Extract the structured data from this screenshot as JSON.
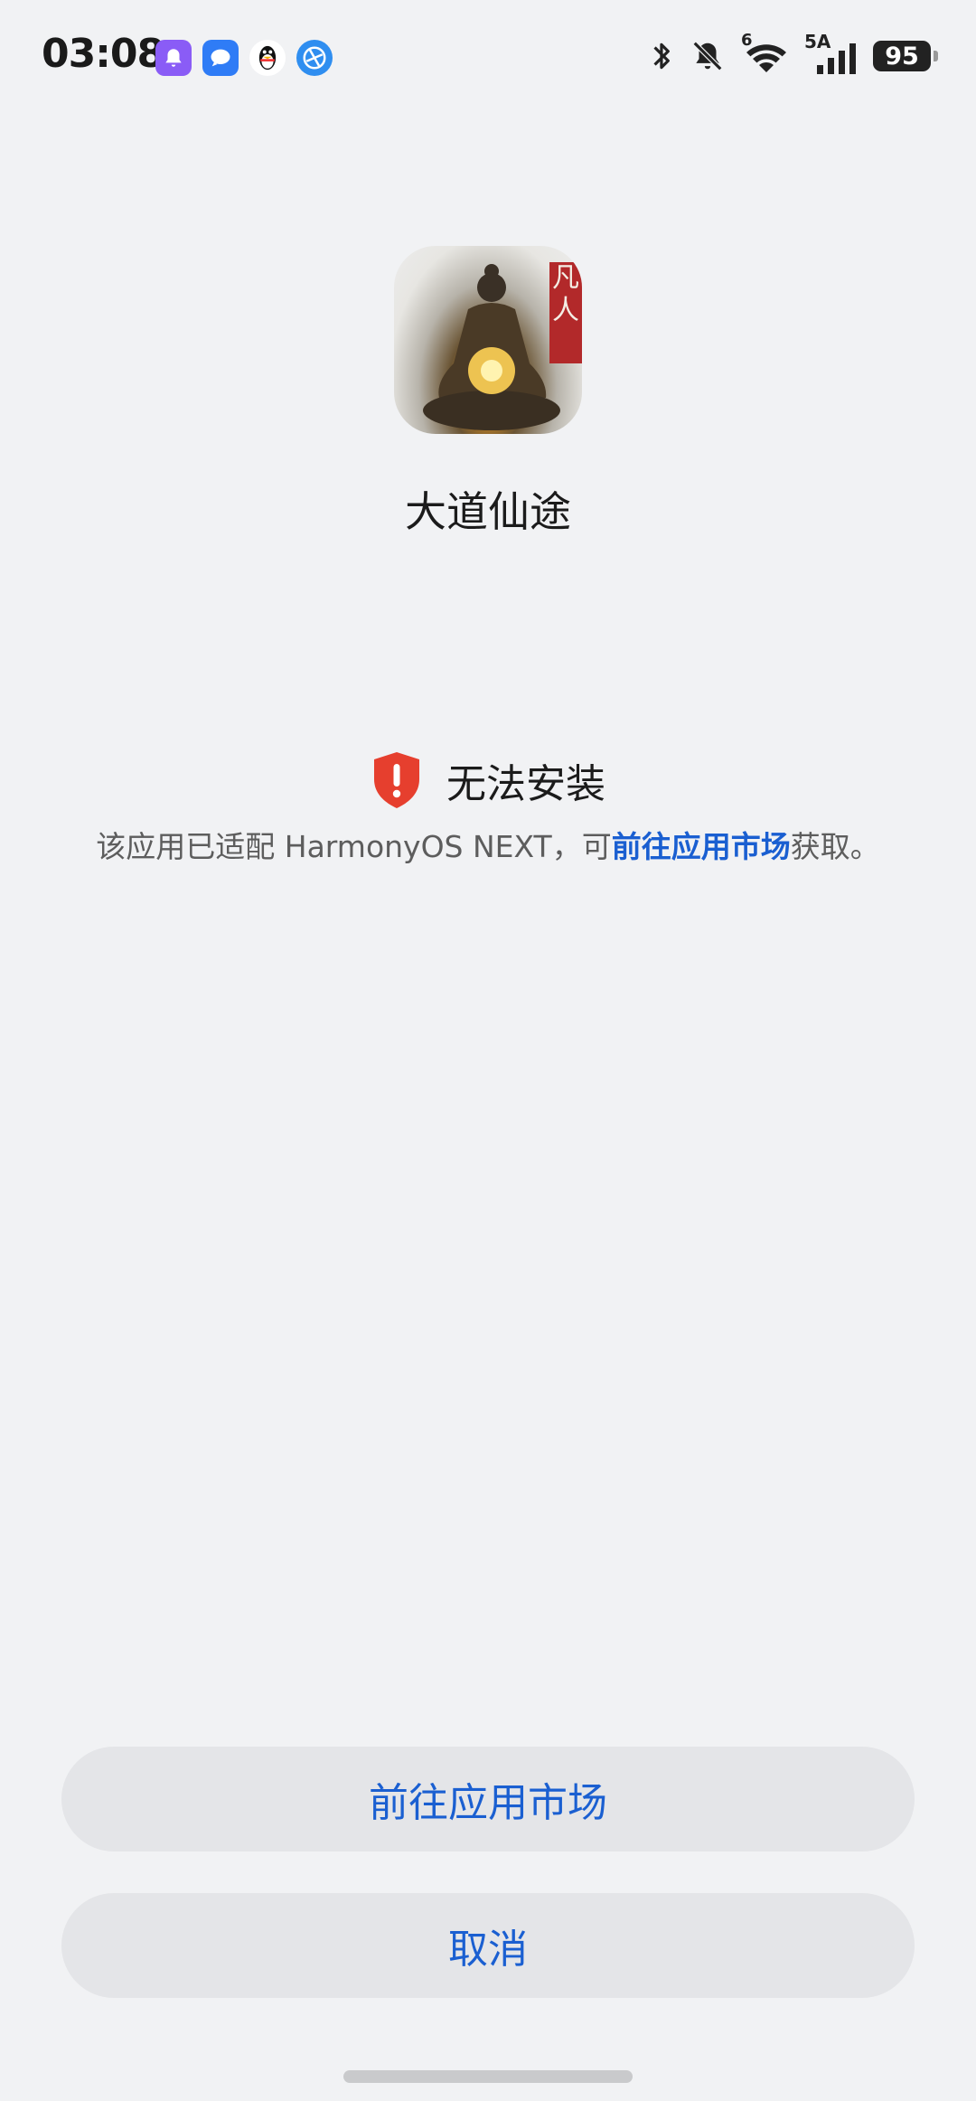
{
  "status_bar": {
    "time": "03:08",
    "network_label": "5A",
    "wifi_label": "6",
    "battery": "95",
    "notification_icons": [
      "bell-app-icon",
      "message-app-icon",
      "qq-penguin-icon",
      "browser-globe-icon"
    ],
    "system_icons": [
      "bluetooth-icon",
      "mute-bell-icon",
      "wifi-icon",
      "cellular-signal-icon",
      "battery-icon"
    ]
  },
  "app": {
    "name": "大道仙途",
    "icon_text": [
      "凡",
      "人"
    ]
  },
  "error": {
    "title": "无法安装",
    "message_prefix": "该应用已适配 HarmonyOS NEXT，可",
    "message_link": "前往应用市场",
    "message_suffix": "获取。",
    "icon_color": "#e63f2e"
  },
  "buttons": {
    "market": "前往应用市场",
    "cancel": "取消"
  },
  "colors": {
    "accent": "#1a5fd1",
    "background": "#f1f2f4",
    "button_bg": "#e4e5e8"
  }
}
